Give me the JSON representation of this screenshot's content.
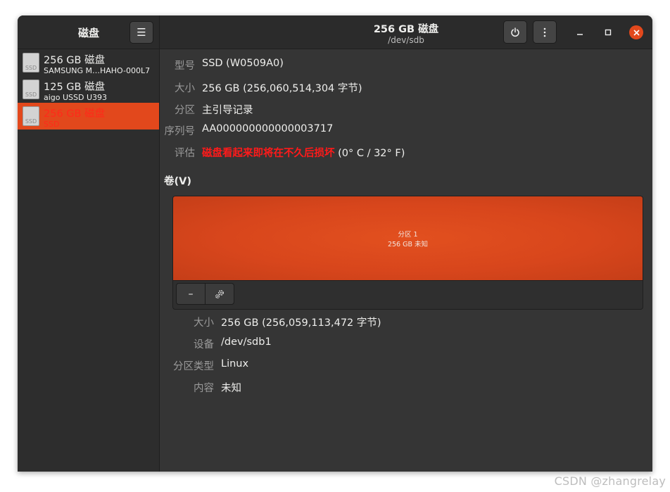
{
  "sidebar": {
    "title": "磁盘",
    "menu_icon": "hamburger-menu-icon",
    "disks": [
      {
        "name": "256 GB 磁盘",
        "subtitle": "SAMSUNG M…HAHO-000L7",
        "icon_label": "SSD",
        "selected": false
      },
      {
        "name": "125 GB 磁盘",
        "subtitle": "aigo USSD U393",
        "icon_label": "SSD",
        "selected": false
      },
      {
        "name": "256 GB 磁盘",
        "subtitle": "SSD",
        "icon_label": "SSD",
        "selected": true
      }
    ]
  },
  "header": {
    "title": "256 GB 磁盘",
    "subtitle": "/dev/sdb",
    "power_icon": "power-icon",
    "more_icon": "more-vertical-icon"
  },
  "drive_info": [
    {
      "label": "型号",
      "value": "SSD (W0509A0)"
    },
    {
      "label": "大小",
      "value": "256 GB (256,060,514,304 字节)"
    },
    {
      "label": "分区",
      "value": "主引导记录"
    },
    {
      "label": "序列号",
      "value": "AA000000000000003717"
    }
  ],
  "assessment": {
    "label": "评估",
    "warning": "磁盘看起来即将在不久后损坏",
    "temperature": " (0° C / 32° F)"
  },
  "volumes": {
    "title": "卷(V)",
    "partition": {
      "name": "分区 1",
      "desc": "256 GB 未知"
    },
    "remove_label": "–",
    "settings_icon": "gears-icon"
  },
  "partition_info": [
    {
      "label": "大小",
      "value": "256 GB (256,059,113,472 字节)"
    },
    {
      "label": "设备",
      "value": "/dev/sdb1"
    },
    {
      "label": "分区类型",
      "value": "Linux"
    },
    {
      "label": "内容",
      "value": "未知"
    }
  ],
  "colors": {
    "accent": "#e2481c",
    "warning": "#ff1a1a",
    "window_bg": "#353535"
  },
  "watermark": "CSDN @zhangrelay"
}
